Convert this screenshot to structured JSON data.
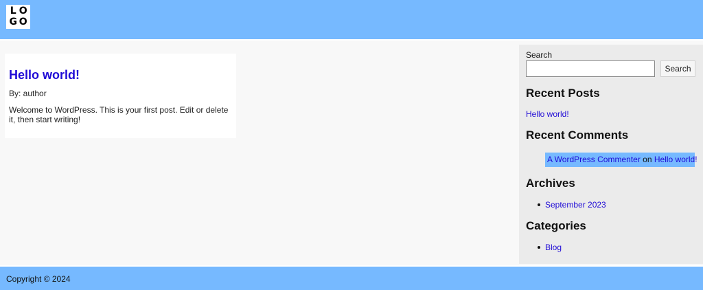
{
  "header": {
    "logo_letters": [
      "L",
      "O",
      "G",
      "O"
    ]
  },
  "post": {
    "title": "Hello world!",
    "author": "By: author",
    "excerpt": "Welcome to WordPress. This is your first post. Edit or delete it, then start writing!"
  },
  "sidebar": {
    "search": {
      "label": "Search",
      "value": "",
      "placeholder": "",
      "button_label": "Search"
    },
    "recent_posts": {
      "title": "Recent Posts",
      "items": [
        "Hello world!"
      ]
    },
    "recent_comments": {
      "title": "Recent Comments",
      "author": "A WordPress Commenter",
      "connector": "on",
      "post": "Hello world!"
    },
    "archives": {
      "title": "Archives",
      "items": [
        "September 2023"
      ]
    },
    "categories": {
      "title": "Categories",
      "items": [
        "Blog"
      ]
    }
  },
  "footer": {
    "copyright": "Copyright © 2024"
  },
  "colors": {
    "header_bg": "#76b9ff",
    "link": "#1f0ad6",
    "main_bg": "#f8f8f8",
    "sidebar_bg": "#ebebeb"
  }
}
